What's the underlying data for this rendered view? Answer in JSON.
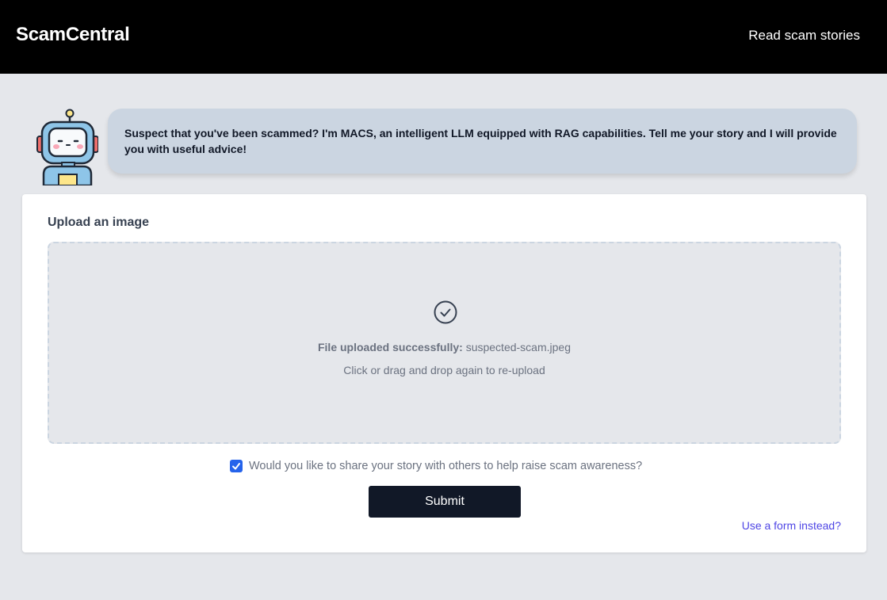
{
  "navbar": {
    "brand": "ScamCentral",
    "link": "Read scam stories"
  },
  "assistant": {
    "avatar_icon": "robot-icon",
    "message": "Suspect that you've been scammed? I'm MACS, an intelligent LLM equipped with RAG capabilities. Tell me your story and I will provide you with useful advice!"
  },
  "upload": {
    "label": "Upload an image",
    "status_icon": "check-circle-icon",
    "success_prefix": "File uploaded successfully:",
    "file_name": "suspected-scam.jpeg",
    "reupload_hint": "Click or drag and drop again to re-upload"
  },
  "share": {
    "checked": true,
    "label": "Would you like to share your story with others to help raise scam awareness?"
  },
  "submit_label": "Submit",
  "alt_link": "Use a form instead?",
  "colors": {
    "navbar_bg": "#000000",
    "page_bg": "#e5e7eb",
    "bubble_bg": "#cbd5e1",
    "button_bg": "#111827",
    "checkbox": "#2563eb",
    "link": "#4f46e5"
  }
}
